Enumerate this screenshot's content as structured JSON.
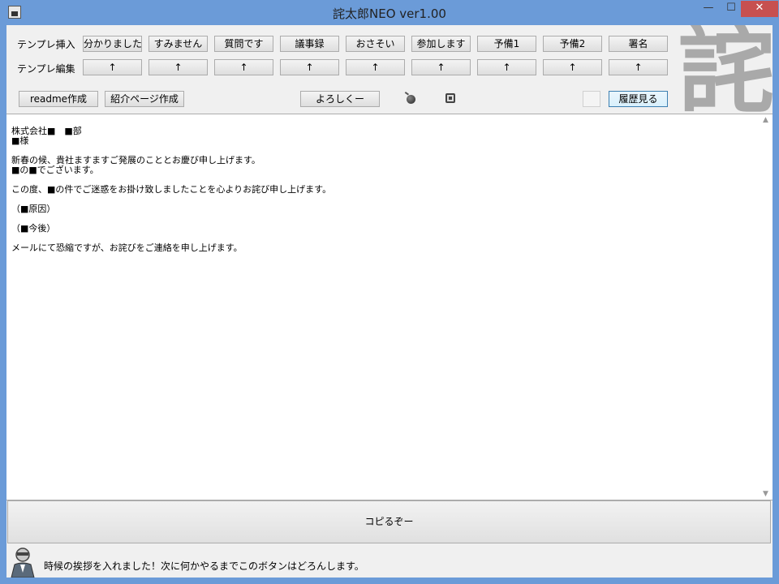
{
  "window": {
    "title": "詫太郎NEO  ver1.00",
    "minimize_symbol": "—",
    "maximize_symbol": "☐",
    "close_symbol": "✕"
  },
  "toolbar": {
    "insert_label": "テンプレ挿入",
    "edit_label": "テンプレ編集",
    "templates": [
      "分かりました",
      "すみません",
      "質問です",
      "議事録",
      "おさそい",
      "参加します",
      "予備1",
      "予備2",
      "署名"
    ],
    "edit_buttons": [
      "↑",
      "↑",
      "↑",
      "↑",
      "↑",
      "↑",
      "↑",
      "↑",
      "↑"
    ],
    "readme_button": "readme作成",
    "intro_button": "紹介ページ作成",
    "regards_button": "よろしくー",
    "history_button": "履歴見る"
  },
  "logo": {
    "glyph": "詫"
  },
  "icons": [
    "bomb-icon",
    "window-icon"
  ],
  "editor": {
    "lines": [
      "株式会社■　■部",
      "■様",
      "",
      "新春の候、貴社ますますご発展のこととお慶び申し上げます。",
      "■の■でございます。",
      "",
      "この度、■の件でご迷惑をお掛け致しましたことを心よりお詫び申し上げます。",
      "",
      "（■原因）",
      "",
      "（■今後）",
      "",
      "メールにて恐縮ですが、お詫びをご連絡を申し上げます。"
    ]
  },
  "copy_button": "コピるぞー",
  "status": {
    "message": "時候の挨拶を入れました！次に何かやるまでこのボタンはどろんします。"
  },
  "colors": {
    "frame": "#6b9bd8",
    "close_button": "#c75050",
    "client_background": "#f0f0f0"
  }
}
